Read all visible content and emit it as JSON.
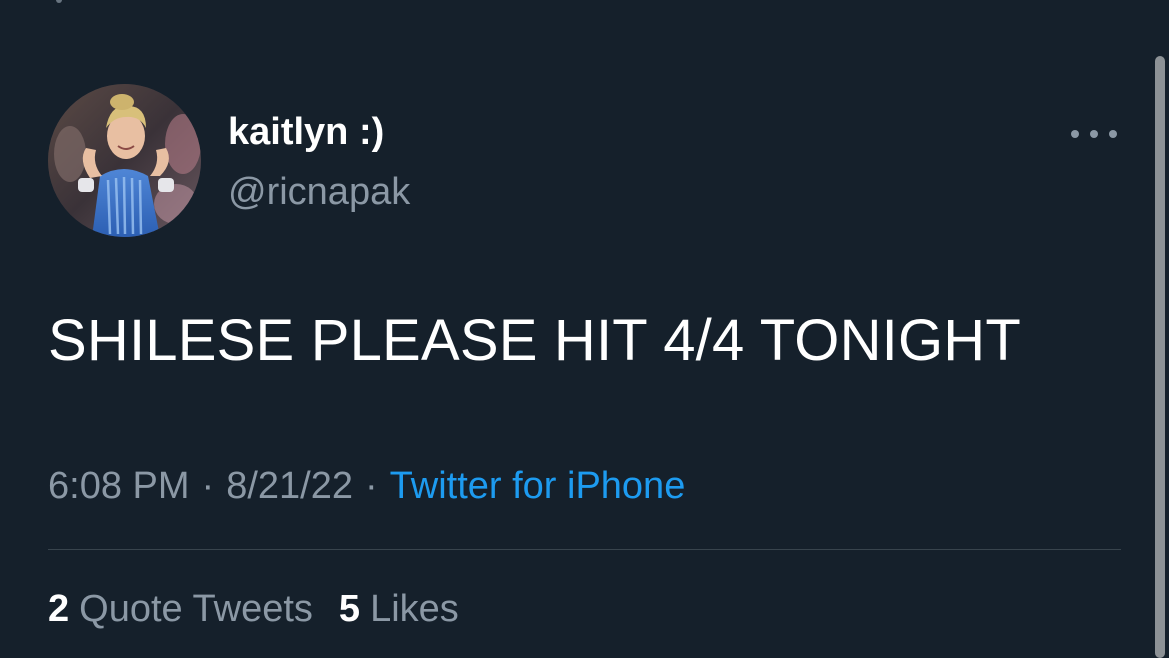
{
  "header": {
    "display_name": "kaitlyn :)",
    "handle": "@ricnapak",
    "avatar_icon": "profile-photo",
    "more_icon": "more-horizontal-icon"
  },
  "tweet": {
    "text": "SHILESE PLEASE HIT 4/4 TONIGHT",
    "time": "6:08 PM",
    "separator": "·",
    "date": "8/21/22",
    "source": "Twitter for iPhone"
  },
  "stats": {
    "quote_tweets_count": "2",
    "quote_tweets_label": "Quote Tweets",
    "likes_count": "5",
    "likes_label": "Likes"
  },
  "colors": {
    "background": "#15202b",
    "primary_text": "#ffffff",
    "secondary_text": "#8b98a5",
    "link": "#1d9bf0",
    "divider": "#38444d"
  }
}
